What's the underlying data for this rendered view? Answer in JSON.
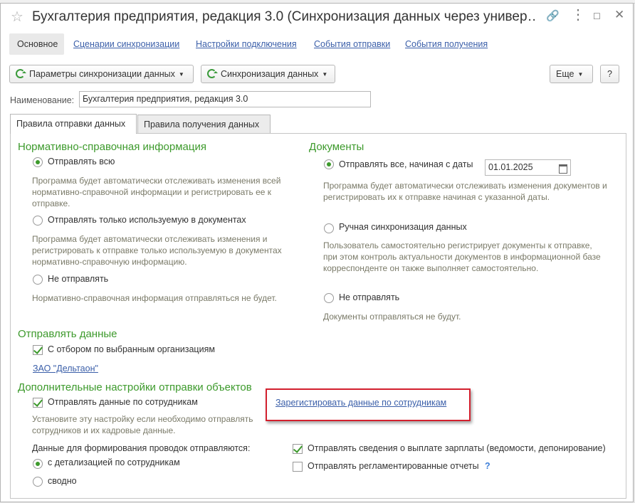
{
  "window": {
    "title": "Бухгалтерия предприятия, редакция 3.0 (Синхронизация данных через универ…"
  },
  "nav": {
    "main": "Основное",
    "links": [
      "Сценарии синхронизации",
      "Настройки подключения",
      "События отправки",
      "События получения"
    ]
  },
  "toolbar": {
    "params": "Параметры синхронизации данных",
    "sync": "Синхронизация данных",
    "more": "Еще",
    "help": "?"
  },
  "name_field": {
    "label": "Наименование:",
    "value": "Бухгалтерия предприятия, редакция 3.0"
  },
  "tabs": [
    "Правила отправки данных",
    "Правила получения данных"
  ],
  "nsi": {
    "title": "Нормативно-справочная информация",
    "opt1": "Отправлять всю",
    "hint1": "Программа будет автоматически отслеживать изменения всей нормативно-справочной информации и регистрировать ее к отправке.",
    "opt2": "Отправлять только используемую в документах",
    "hint2": "Программа будет автоматически отслеживать изменения и регистрировать к отправке только используемую в документах нормативно-справочную информацию.",
    "opt3": "Не отправлять",
    "hint3": "Нормативно-справочная информация отправляться не будет."
  },
  "docs": {
    "title": "Документы",
    "opt1": "Отправлять все, начиная с даты",
    "date": "01.01.2025",
    "hint1": "Программа будет автоматически отслеживать изменения документов и регистрировать их к отправке начиная с указанной даты.",
    "opt2": "Ручная синхронизация данных",
    "hint2": "Пользователь самостоятельно регистрирует документы к отправке, при этом контроль актуальности документов в информационной базе корреспонденте он также выполняет самостоятельно.",
    "opt3": "Не отправлять",
    "hint3": "Документы отправляться не будут."
  },
  "send_data": {
    "title": "Отправлять данные",
    "check": "С отбором по выбранным организациям",
    "org_link": "ЗАО \"Дельтаон\""
  },
  "extra": {
    "title": "Дополнительные настройки отправки объектов",
    "emp_check": "Отправлять данные по сотрудникам",
    "register_link": "Зарегистировать данные по сотрудникам",
    "emp_hint": "Установите эту настройку если необходимо отправлять сотрудников и их кадровые данные.",
    "postings_label": "Данные для формирования проводок отправляются:",
    "radio1": "с детализацией по сотрудникам",
    "radio2": "сводно",
    "salary_check": "Отправлять сведения о выплате зарплаты (ведомости, депонирование)",
    "reports_check": "Отправлять регламентированные отчеты",
    "reports_help": "?"
  }
}
